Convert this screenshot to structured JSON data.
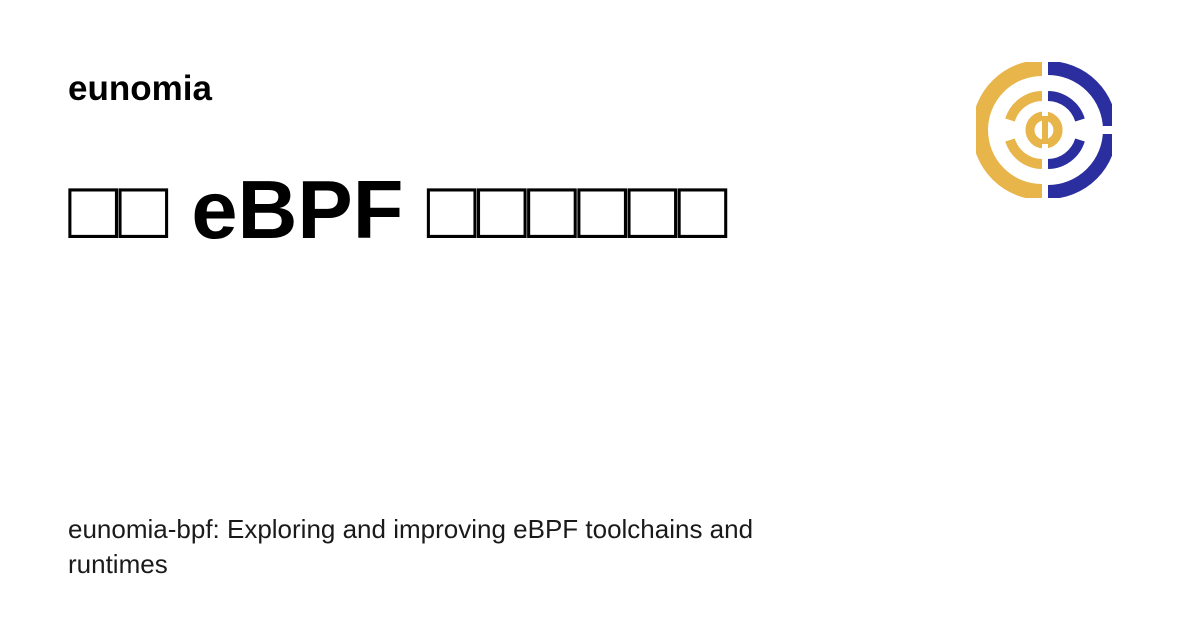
{
  "header": {
    "site_name": "eunomia"
  },
  "main": {
    "title": "□□ eBPF □□□□□□",
    "description": "eunomia-bpf: Exploring and improving eBPF toolchains and runtimes"
  },
  "logo": {
    "icon": "eunomia-logo-icon",
    "colors": {
      "left": "#E8B54A",
      "right": "#2A2E9E"
    }
  }
}
